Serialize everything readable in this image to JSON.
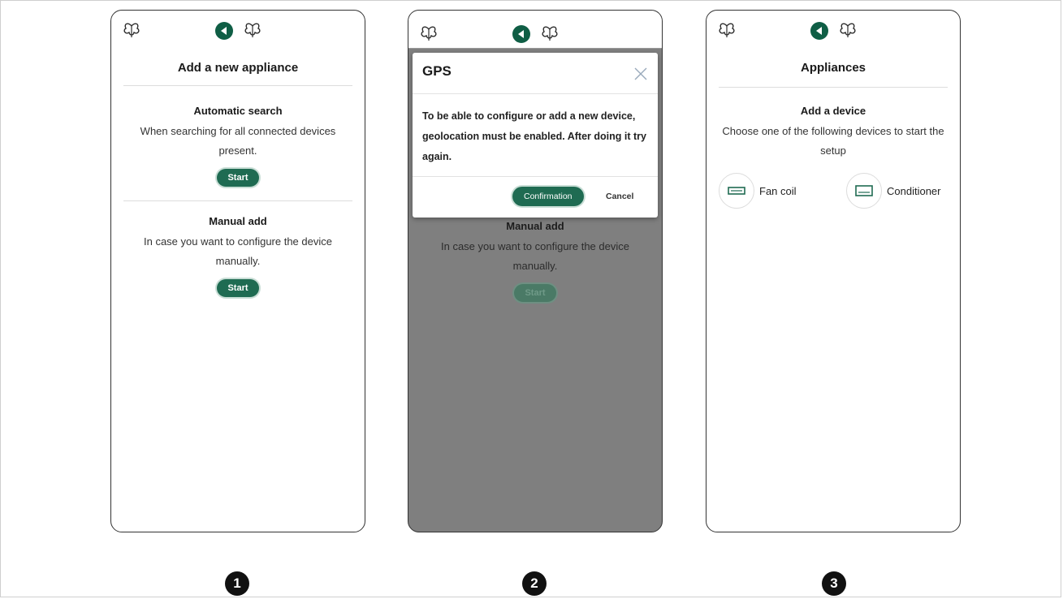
{
  "colors": {
    "accent": "#1f6b52",
    "back_button": "#0f5e45",
    "overlay": "#7f7f7f"
  },
  "screen1": {
    "title": "Add a new appliance",
    "automatic": {
      "heading": "Automatic search",
      "text": "When searching for all connected devices present.",
      "button": "Start"
    },
    "manual": {
      "heading": "Manual add",
      "text": "In case you want to configure the device manually.",
      "button": "Start"
    }
  },
  "screen2": {
    "dialog": {
      "title": "GPS",
      "body": "To be able to configure or add a new device, geolocation must be enabled. After doing it try again.",
      "confirm": "Confirmation",
      "cancel": "Cancel"
    },
    "manual": {
      "heading": "Manual add",
      "text": "In case you want to configure the device manually.",
      "button": "Start"
    }
  },
  "screen3": {
    "title": "Appliances",
    "add": {
      "heading": "Add a device",
      "text": "Choose one of the following devices to start the setup"
    },
    "devices": [
      {
        "label": "Fan coil",
        "icon": "fan-coil-icon"
      },
      {
        "label": "Conditioner",
        "icon": "air-conditioner-icon"
      }
    ]
  },
  "steps": [
    "1",
    "2",
    "3"
  ]
}
